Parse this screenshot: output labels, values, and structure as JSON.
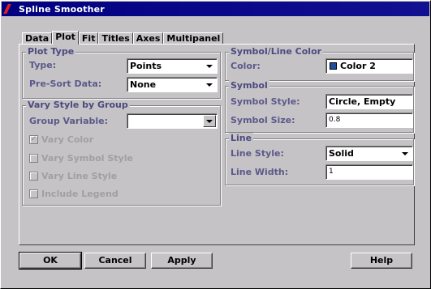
{
  "window": {
    "title": "Spline Smoother"
  },
  "tabs": [
    {
      "label": "Data"
    },
    {
      "label": "Plot"
    },
    {
      "label": "Fit"
    },
    {
      "label": "Titles"
    },
    {
      "label": "Axes"
    },
    {
      "label": "Multipanel"
    }
  ],
  "active_tab": "Plot",
  "plot_type": {
    "title": "Plot Type",
    "type_label": "Type:",
    "type_value": "Points",
    "presort_label": "Pre-Sort Data:",
    "presort_value": "None"
  },
  "vary_style": {
    "title": "Vary Style by Group",
    "group_variable_label": "Group Variable:",
    "group_variable_value": "",
    "vary_color": "Vary Color",
    "vary_symbol_style": "Vary Symbol Style",
    "vary_line_style": "Vary Line Style",
    "include_legend": "Include Legend"
  },
  "symbol_line_color": {
    "title": "Symbol/Line Color",
    "color_label": "Color:",
    "color_value": "Color 2",
    "swatch_color": "#1e4fa0"
  },
  "symbol": {
    "title": "Symbol",
    "style_label": "Symbol Style:",
    "style_value": "Circle, Empty",
    "size_label": "Symbol Size:",
    "size_value": "0.8"
  },
  "line": {
    "title": "Line",
    "style_label": "Line Style:",
    "style_value": "Solid",
    "width_label": "Line Width:",
    "width_value": "1"
  },
  "buttons": {
    "ok": "OK",
    "cancel": "Cancel",
    "apply": "Apply",
    "help": "Help"
  }
}
